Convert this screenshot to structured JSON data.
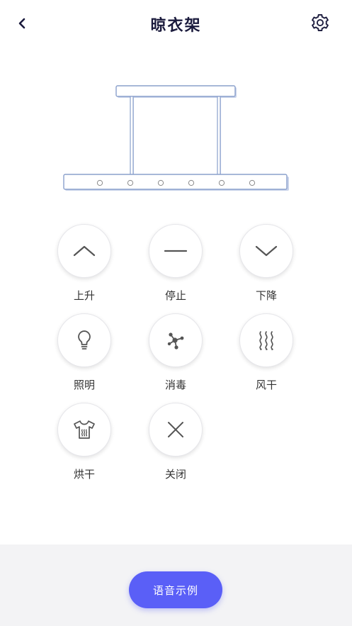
{
  "header": {
    "title": "晾衣架"
  },
  "controls": [
    {
      "label": "上升",
      "icon": "chevron-up-icon"
    },
    {
      "label": "停止",
      "icon": "minus-icon"
    },
    {
      "label": "下降",
      "icon": "chevron-down-icon"
    },
    {
      "label": "照明",
      "icon": "bulb-icon"
    },
    {
      "label": "消毒",
      "icon": "disinfect-icon"
    },
    {
      "label": "风干",
      "icon": "air-dry-icon"
    },
    {
      "label": "烘干",
      "icon": "heat-dry-icon"
    },
    {
      "label": "关闭",
      "icon": "close-icon"
    }
  ],
  "voice_button": {
    "label": "语音示例"
  },
  "colors": {
    "accent": "#5a5ff7",
    "title": "#1a1a3c",
    "icon": "#555555",
    "rack_outline": "#8aa0cc"
  }
}
